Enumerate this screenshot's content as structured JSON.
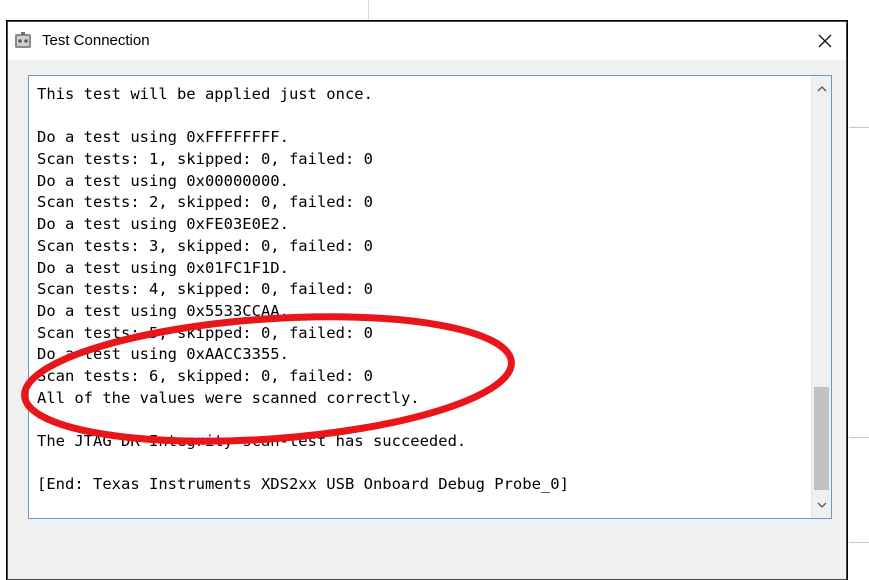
{
  "dialog": {
    "title": "Test Connection",
    "output_lines": [
      "This test will be applied just once.",
      "",
      "Do a test using 0xFFFFFFFF.",
      "Scan tests: 1, skipped: 0, failed: 0",
      "Do a test using 0x00000000.",
      "Scan tests: 2, skipped: 0, failed: 0",
      "Do a test using 0xFE03E0E2.",
      "Scan tests: 3, skipped: 0, failed: 0",
      "Do a test using 0x01FC1F1D.",
      "Scan tests: 4, skipped: 0, failed: 0",
      "Do a test using 0x5533CCAA.",
      "Scan tests: 5, skipped: 0, failed: 0",
      "Do a test using 0xAACC3355.",
      "Scan tests: 6, skipped: 0, failed: 0",
      "All of the values were scanned correctly.",
      "",
      "The JTAG DR Integrity scan-test has succeeded.",
      "",
      "[End: Texas Instruments XDS2xx USB Onboard Debug Probe_0]"
    ]
  },
  "annotation": {
    "color": "#e8151b"
  }
}
